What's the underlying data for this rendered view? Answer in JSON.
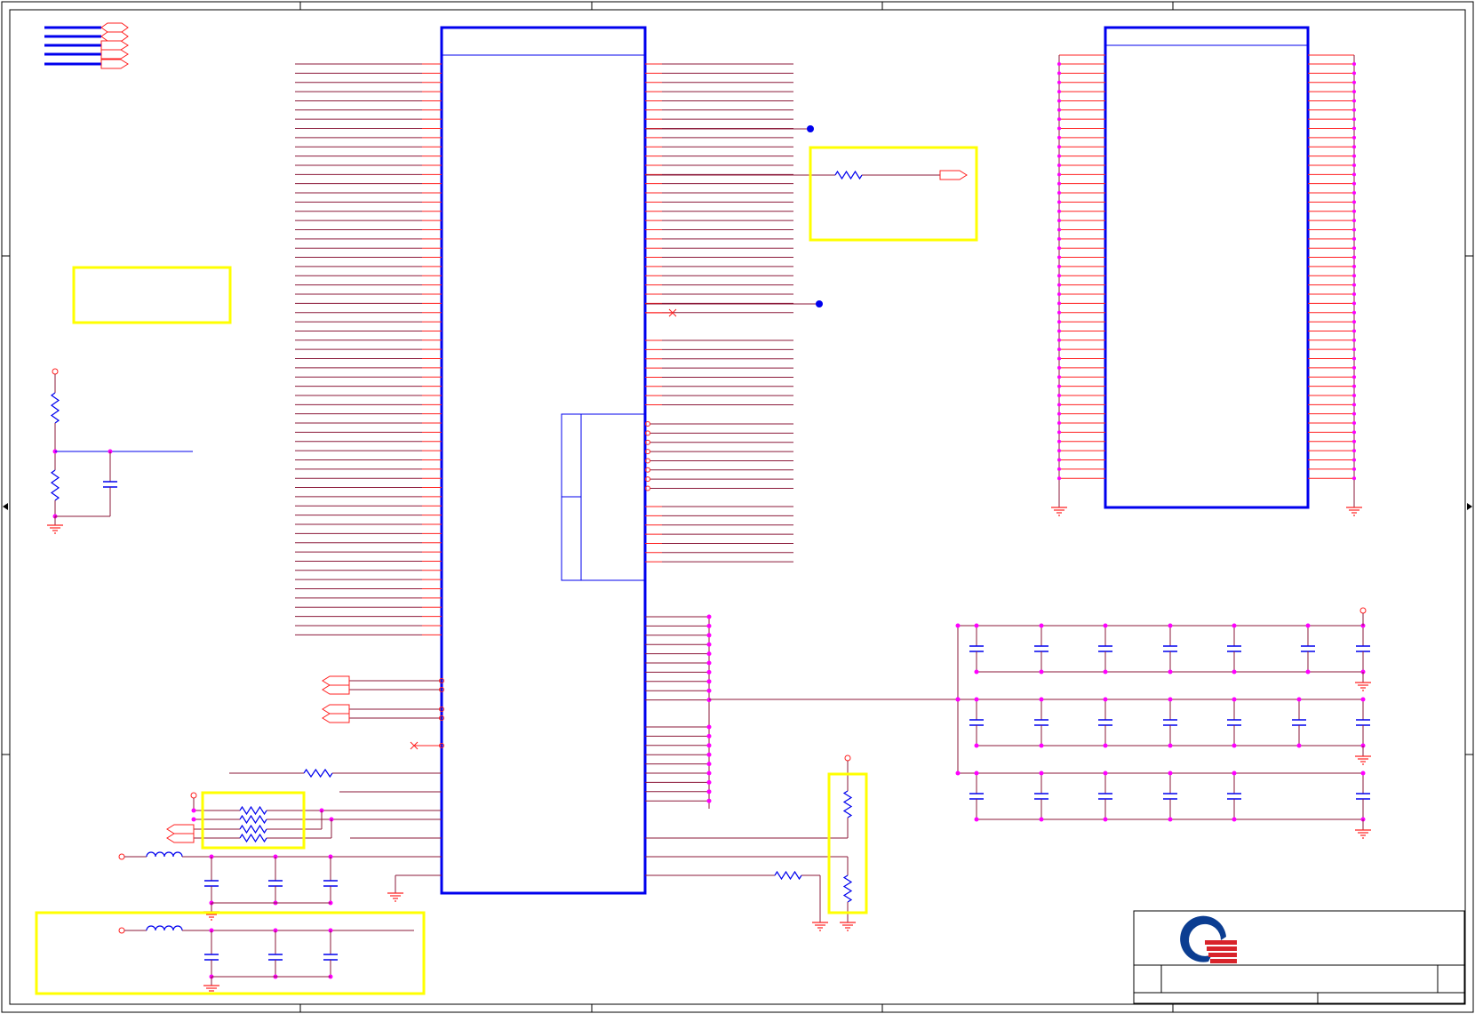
{
  "colors": {
    "border": "#000000",
    "wire": "#8b1a3a",
    "pin": "#ff2020",
    "symbol": "#0000ee",
    "junction": "#ff00ff",
    "highlight": "#ffff00",
    "logo_blue": "#0b3d91",
    "logo_red": "#d8232a"
  },
  "icons": {
    "logo": "company-logo-icon",
    "ground": "ground-icon",
    "resistor": "resistor-icon",
    "capacitor": "capacitor-icon",
    "inductor": "inductor-icon",
    "offpage": "offpage-connector-icon",
    "power": "power-port-icon",
    "junction": "junction-dot-icon",
    "noconnect": "no-connect-icon"
  }
}
